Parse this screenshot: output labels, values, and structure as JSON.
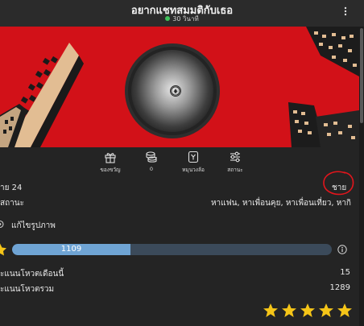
{
  "header": {
    "title": "อยากแชทสมมติกับเธอ",
    "status": "30 วินาที",
    "status_color": "#3ec15a",
    "menu_icon": "kebab-menu-icon"
  },
  "banner": {
    "background_color": "#d21118",
    "building_color": "#e2bd93",
    "profile_image": "blurred avatar"
  },
  "toolbar": {
    "items": [
      {
        "icon": "gift-icon",
        "label": "ของขวัญ"
      },
      {
        "icon": "coins-icon",
        "label": "0"
      },
      {
        "icon": "dice-icon",
        "label": "หมุนวงล้อ"
      },
      {
        "icon": "sliders-icon",
        "label": "สถานะ"
      }
    ]
  },
  "profile": {
    "gender_age": "าย 24",
    "gender_badge": "ชาย",
    "status_label": "สถานะ",
    "status_value": "หาแฟน, หาเพื่อนคุย, หาเพื่อนเที่ยว, หากิ",
    "edit_label": "แก้ไขรูปภาพ"
  },
  "level": {
    "points": "1109",
    "progress_fraction": 0.37,
    "track_color": "#3b4a5a",
    "fill_color": "#6fa4d4"
  },
  "stats": {
    "monthly_label": "ะแนนโหวตเดือนนี้",
    "monthly_value": "15",
    "total_label": "ะแนนโหวตรวม",
    "total_value": "1289"
  },
  "rating": {
    "stars": 5,
    "max": 5,
    "star_color": "#f5c518"
  }
}
